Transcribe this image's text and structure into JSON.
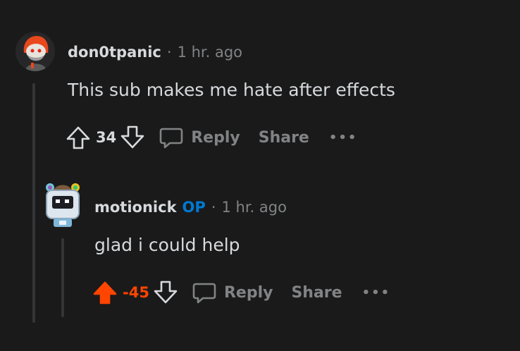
{
  "comments": [
    {
      "author": "don0tpanic",
      "separator": "·",
      "time": "1 hr. ago",
      "body": "This sub makes me hate after effects",
      "score": "34",
      "vote_state": "none",
      "reply_label": "Reply",
      "share_label": "Share",
      "more_label": "•••"
    },
    {
      "author": "motionick",
      "badge": "OP",
      "separator": "·",
      "time": "1 hr. ago",
      "body": "glad i could help",
      "score": "-45",
      "vote_state": "upvoted",
      "reply_label": "Reply",
      "share_label": "Share",
      "more_label": "•••"
    }
  ],
  "colors": {
    "background": "#1a1a1b",
    "text": "#d7dadc",
    "muted": "#818384",
    "op_badge": "#0079d3",
    "upvote_active": "#ff4500"
  }
}
